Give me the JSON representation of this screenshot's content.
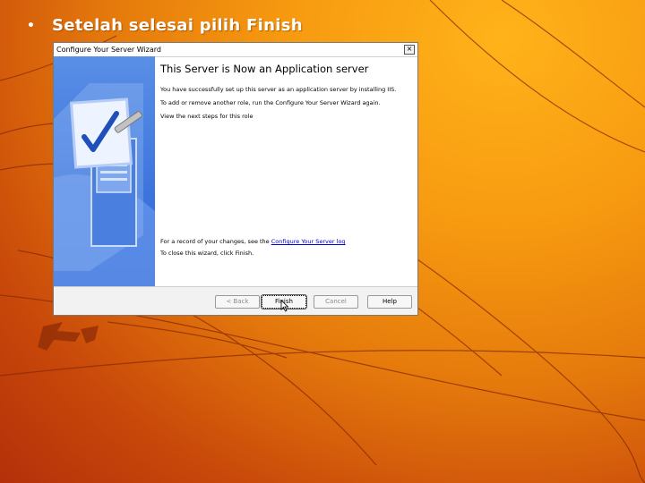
{
  "slide": {
    "bullet_symbol": "•",
    "bullet_text": "Setelah selesai pilih Finish"
  },
  "wizard": {
    "title": "Configure Your Server Wizard",
    "close_symbol": "×",
    "heading": "This Server is Now an Application server",
    "para1": "You have successfully set up this server as an application server by installing IIS.",
    "para2": "To add or remove another role, run the Configure Your Server Wizard again.",
    "para3": "View the next steps for this role",
    "record_prefix": "For a record of your changes, see the ",
    "record_link": "Configure Your Server log",
    "close_instruction": "To close this wizard, click Finish.",
    "buttons": {
      "back": "< Back",
      "finish": "Finish",
      "cancel": "Cancel",
      "help": "Help"
    },
    "colors": {
      "side_panel": "#3c74dd",
      "link": "#0000cc"
    }
  },
  "icons": [
    "server-checkmark-icon",
    "mouse-cursor-icon",
    "close-icon"
  ]
}
